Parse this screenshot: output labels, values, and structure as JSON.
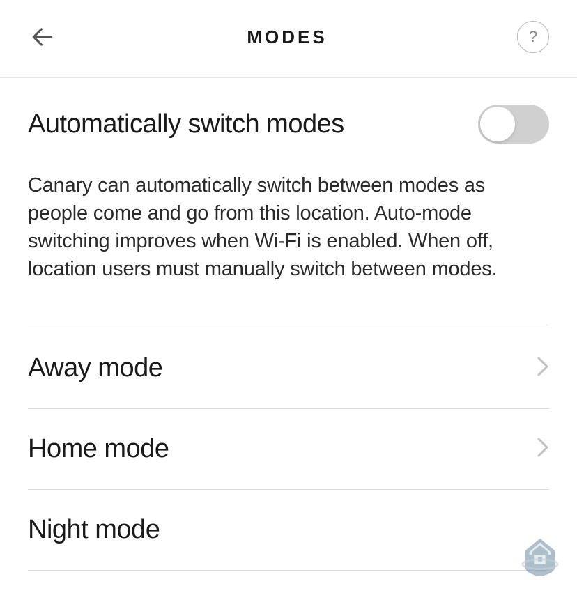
{
  "header": {
    "title": "MODES",
    "help_label": "?"
  },
  "auto_switch": {
    "label": "Automatically switch modes",
    "enabled": false,
    "description": "Canary can automatically switch between modes as people come and go from this location. Auto-mode switching improves when Wi-Fi is enabled. When off, location users must manually switch between modes."
  },
  "modes": [
    {
      "label": "Away mode"
    },
    {
      "label": "Home mode"
    },
    {
      "label": "Night mode"
    }
  ]
}
